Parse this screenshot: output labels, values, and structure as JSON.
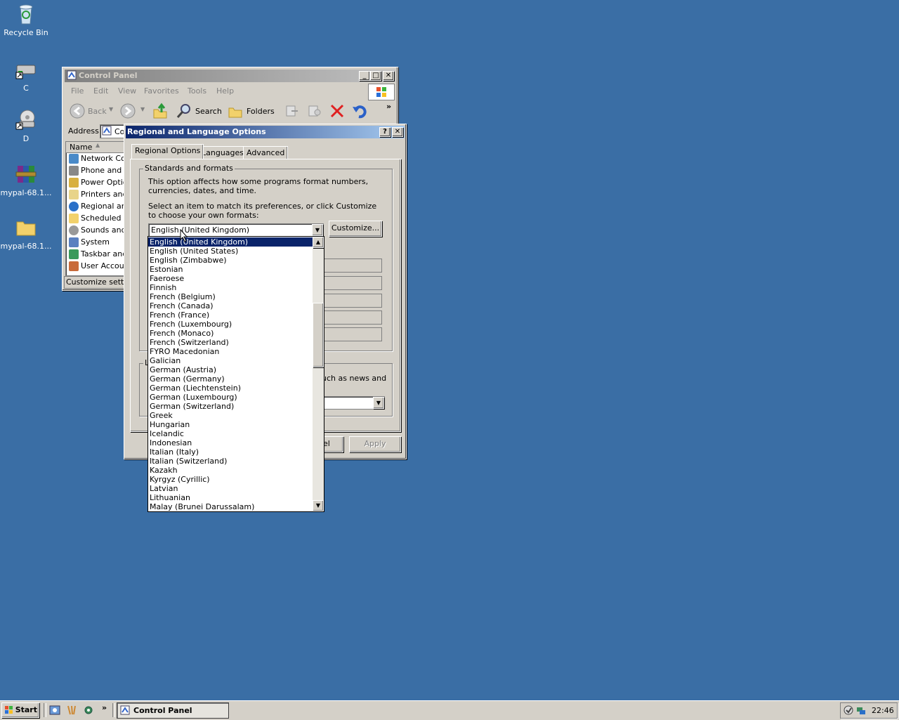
{
  "desktop": {
    "icons": [
      {
        "label": "Recycle Bin",
        "icon": "recycle-bin-icon"
      },
      {
        "label": "C",
        "icon": "drive-icon"
      },
      {
        "label": "D",
        "icon": "cd-drive-icon"
      },
      {
        "label": "mypal-68.1...",
        "icon": "archive-icon"
      },
      {
        "label": "mypal-68.1...",
        "icon": "folder-icon"
      }
    ]
  },
  "control_panel": {
    "title": "Control Panel",
    "menu": [
      "File",
      "Edit",
      "View",
      "Favorites",
      "Tools",
      "Help"
    ],
    "toolbar": {
      "back": "Back",
      "search": "Search",
      "folders": "Folders",
      "more": "»"
    },
    "address_label": "Address",
    "address_value": "Co",
    "column_name": "Name",
    "items": [
      "Network Con",
      "Phone and M",
      "Power Optio",
      "Printers and",
      "Regional anc",
      "Scheduled Ta",
      "Sounds and ,",
      "System",
      "Taskbar and",
      "User Accoun"
    ],
    "status": "Customize setting"
  },
  "dialog": {
    "title": "Regional and Language Options",
    "help_btn": "?",
    "close_btn": "✕",
    "tabs": [
      "Regional Options",
      "Languages",
      "Advanced"
    ],
    "group1_label": "Standards and formats",
    "desc1": "This option affects how some programs format numbers, currencies, dates, and time.",
    "desc2": "Select an item to match its preferences, or click Customize to choose your own formats:",
    "selected_format": "English (United Kingdom)",
    "customize_btn": "Customize...",
    "group2_label": "L",
    "group2_text": "uch as news and",
    "cancel_partial": "el",
    "apply_btn": "Apply"
  },
  "dropdown": {
    "items": [
      "English (United Kingdom)",
      "English (United States)",
      "English (Zimbabwe)",
      "Estonian",
      "Faeroese",
      "Finnish",
      "French (Belgium)",
      "French (Canada)",
      "French (France)",
      "French (Luxembourg)",
      "French (Monaco)",
      "French (Switzerland)",
      "FYRO Macedonian",
      "Galician",
      "German (Austria)",
      "German (Germany)",
      "German (Liechtenstein)",
      "German (Luxembourg)",
      "German (Switzerland)",
      "Greek",
      "Hungarian",
      "Icelandic",
      "Indonesian",
      "Italian (Italy)",
      "Italian (Switzerland)",
      "Kazakh",
      "Kyrgyz (Cyrillic)",
      "Latvian",
      "Lithuanian",
      "Malay (Brunei Darussalam)"
    ],
    "selected_index": 0
  },
  "taskbar": {
    "start": "Start",
    "quicklaunch_more": "»",
    "task_label": "Control Panel",
    "clock": "22:46"
  }
}
